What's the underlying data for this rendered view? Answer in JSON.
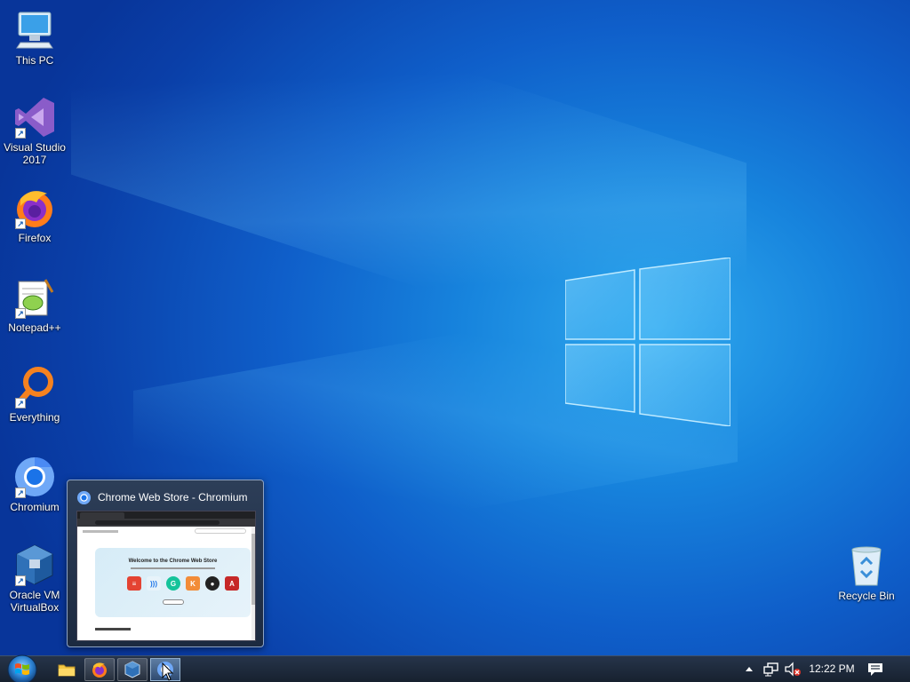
{
  "desktop": {
    "icons": [
      {
        "label": "This PC"
      },
      {
        "label": "Visual Studio\n2017"
      },
      {
        "label": "Firefox"
      },
      {
        "label": "Notepad++"
      },
      {
        "label": "Everything"
      },
      {
        "label": "Chromium"
      },
      {
        "label": "Oracle VM\nVirtualBox"
      },
      {
        "label": "Recycle Bin"
      }
    ]
  },
  "preview": {
    "title": "Chrome Web Store - Chromium",
    "page_heading": "Welcome to the Chrome Web Store"
  },
  "taskbar": {
    "buttons": [
      {
        "icon": "file-explorer-icon"
      },
      {
        "icon": "firefox-icon"
      },
      {
        "icon": "virtualbox-icon"
      },
      {
        "icon": "chromium-icon",
        "active": true
      }
    ]
  },
  "tray": {
    "clock": "12:22 PM",
    "icons": [
      "show-hidden-icons-chevron-icon",
      "network-icon",
      "volume-muted-icon",
      "action-center-icon"
    ]
  },
  "colors": {
    "taskbar": "#1d2a3b",
    "wallpaper_blue": "#1784dd",
    "chromium_blue": "#4a8af4"
  }
}
